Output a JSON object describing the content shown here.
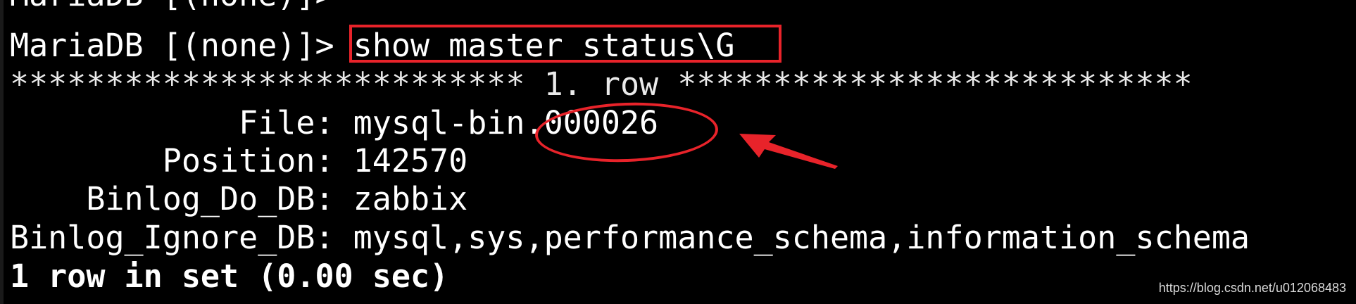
{
  "terminal": {
    "lines": {
      "cut_prompt": "MariaDB [(none)]>",
      "prompt": "MariaDB [(none)]> ",
      "command": "show master status\\G",
      "row_separator": "*************************** 1. row ***************************",
      "file": "            File: mysql-bin.000026",
      "position": "        Position: 142570",
      "binlog_do_db": "    Binlog_Do_DB: zabbix",
      "binlog_ignore_db": "Binlog_Ignore_DB: mysql,sys,performance_schema,information_schema",
      "result_summary": "1 row in set (0.00 sec)"
    }
  },
  "annotations": {
    "highlight_color": "#e8232a"
  },
  "watermark": "https://blog.csdn.net/u012068483",
  "colors": {
    "background": "#000000",
    "text": "#ffffff"
  }
}
